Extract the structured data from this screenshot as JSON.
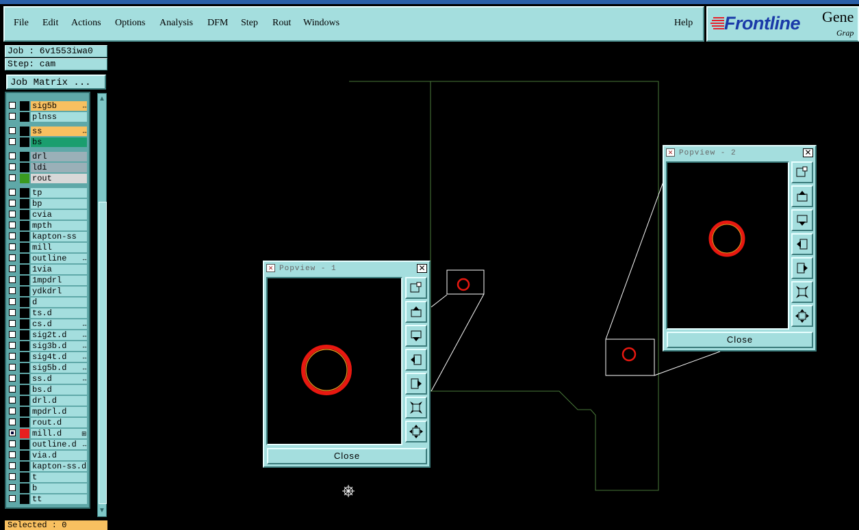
{
  "window": {
    "title_strip_color": "#2a5fa8"
  },
  "menubar": {
    "items": [
      {
        "label": "File"
      },
      {
        "label": "Edit"
      },
      {
        "label": "Actions"
      },
      {
        "label": "Options"
      },
      {
        "label": "Analysis"
      },
      {
        "label": "DFM"
      },
      {
        "label": "Step"
      },
      {
        "label": "Rout"
      },
      {
        "label": "Windows"
      }
    ],
    "help_label": "Help"
  },
  "logo": {
    "brand": "Frontline",
    "product": "Gene",
    "sub": "Grap"
  },
  "sidebar": {
    "job": "Job : 6v1553iwa0",
    "step": "Step: cam",
    "job_matrix": "Job Matrix ...",
    "selected": "Selected : 0",
    "layers": [
      {
        "name": "sig5b",
        "color": "#f8c060",
        "mark": "↔",
        "swatch": "#000"
      },
      {
        "name": "plnss",
        "color": "#a4dede",
        "mark": "",
        "swatch": "#000"
      },
      {
        "name": "ss",
        "color": "#f8c060",
        "mark": "↔",
        "swatch": "#000"
      },
      {
        "name": "bs",
        "color": "#1a9e6e",
        "mark": "",
        "swatch": "#000"
      },
      {
        "name": "drl",
        "color": "#9ab0b8",
        "mark": "",
        "swatch": "#000"
      },
      {
        "name": "ldi",
        "color": "#9ab0b8",
        "mark": "",
        "swatch": "#000"
      },
      {
        "name": "rout",
        "color": "#d8d8d8",
        "mark": "",
        "swatch": "#3a9a20"
      },
      {
        "name": "tp",
        "color": "#a4dede",
        "mark": "",
        "swatch": "#000"
      },
      {
        "name": "bp",
        "color": "#a4dede",
        "mark": "",
        "swatch": "#000"
      },
      {
        "name": "cvia",
        "color": "#a4dede",
        "mark": "",
        "swatch": "#000"
      },
      {
        "name": "mpth",
        "color": "#a4dede",
        "mark": "",
        "swatch": "#000"
      },
      {
        "name": "kapton-ss",
        "color": "#a4dede",
        "mark": "",
        "swatch": "#000"
      },
      {
        "name": "mill",
        "color": "#a4dede",
        "mark": "",
        "swatch": "#000"
      },
      {
        "name": "outline",
        "color": "#a4dede",
        "mark": "↔",
        "swatch": "#000"
      },
      {
        "name": "1via",
        "color": "#a4dede",
        "mark": "",
        "swatch": "#000"
      },
      {
        "name": "1mpdrl",
        "color": "#a4dede",
        "mark": "",
        "swatch": "#000"
      },
      {
        "name": "ydkdrl",
        "color": "#a4dede",
        "mark": "",
        "swatch": "#000"
      },
      {
        "name": "d",
        "color": "#a4dede",
        "mark": "",
        "swatch": "#000"
      },
      {
        "name": "ts.d",
        "color": "#a4dede",
        "mark": "",
        "swatch": "#000"
      },
      {
        "name": "cs.d",
        "color": "#a4dede",
        "mark": "↔",
        "swatch": "#000"
      },
      {
        "name": "sig2t.d",
        "color": "#a4dede",
        "mark": "↔",
        "swatch": "#000"
      },
      {
        "name": "sig3b.d",
        "color": "#a4dede",
        "mark": "↔",
        "swatch": "#000"
      },
      {
        "name": "sig4t.d",
        "color": "#a4dede",
        "mark": "↔",
        "swatch": "#000"
      },
      {
        "name": "sig5b.d",
        "color": "#a4dede",
        "mark": "↔",
        "swatch": "#000"
      },
      {
        "name": "ss.d",
        "color": "#a4dede",
        "mark": "↔",
        "swatch": "#000"
      },
      {
        "name": "bs.d",
        "color": "#a4dede",
        "mark": "",
        "swatch": "#000"
      },
      {
        "name": "drl.d",
        "color": "#a4dede",
        "mark": "",
        "swatch": "#000"
      },
      {
        "name": "mpdrl.d",
        "color": "#a4dede",
        "mark": "",
        "swatch": "#000"
      },
      {
        "name": "rout.d",
        "color": "#a4dede",
        "mark": "",
        "swatch": "#000"
      },
      {
        "name": "mill.d",
        "color": "#a4dede",
        "mark": "⊞",
        "swatch": "#e82020",
        "checked": true
      },
      {
        "name": "outline.d",
        "color": "#a4dede",
        "mark": "↔",
        "swatch": "#000"
      },
      {
        "name": "via.d",
        "color": "#a4dede",
        "mark": "",
        "swatch": "#000"
      },
      {
        "name": "kapton-ss.d",
        "color": "#a4dede",
        "mark": "",
        "swatch": "#000"
      },
      {
        "name": "t",
        "color": "#a4dede",
        "mark": "",
        "swatch": "#000"
      },
      {
        "name": "b",
        "color": "#a4dede",
        "mark": "",
        "swatch": "#000"
      },
      {
        "name": "tt",
        "color": "#a4dede",
        "mark": "",
        "swatch": "#000"
      }
    ]
  },
  "popview1": {
    "title": "Popview - 1",
    "close_label": "Close"
  },
  "popview2": {
    "title": "Popview - 2",
    "close_label": "Close"
  },
  "colors": {
    "outline": "#4a7a3a",
    "pad": "#e81810",
    "pad_inner": "#f0a020",
    "leader": "#ffffff"
  }
}
